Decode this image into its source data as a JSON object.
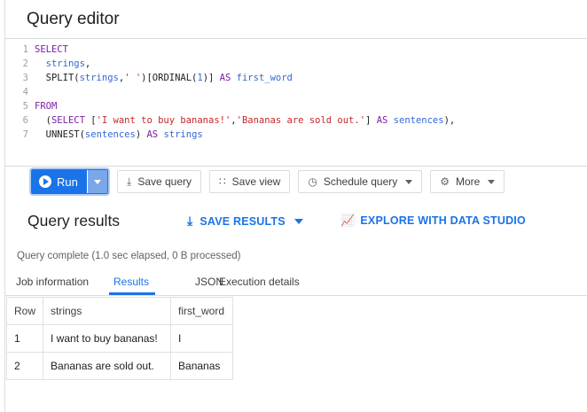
{
  "editor": {
    "title": "Query editor",
    "lines": [
      {
        "n": "1"
      },
      {
        "n": "2"
      },
      {
        "n": "3"
      },
      {
        "n": "4"
      },
      {
        "n": "5"
      },
      {
        "n": "6"
      },
      {
        "n": "7"
      }
    ],
    "code": {
      "l1_kw": "SELECT",
      "l2_id": "strings",
      "l2_txt": ",",
      "l3_a": "SPLIT(",
      "l3_id": "strings",
      "l3_b": ",",
      "l3_str": "' '",
      "l3_c": ")[ORDINAL(",
      "l3_num": "1",
      "l3_d": ")] ",
      "l3_kw": "AS",
      "l3_alias": "first_word",
      "l5_kw": "FROM",
      "l6_a": "(",
      "l6_kw1": "SELECT",
      "l6_b": " [",
      "l6_str1": "'I want to buy bananas!'",
      "l6_c": ",",
      "l6_str2": "'Bananas are sold out.'",
      "l6_d": "] ",
      "l6_kw2": "AS",
      "l6_alias": "sentences",
      "l6_e": "),",
      "l7_a": "UNNEST(",
      "l7_id": "sentences",
      "l7_b": ") ",
      "l7_kw": "AS",
      "l7_alias": "strings"
    }
  },
  "toolbar": {
    "run": "Run",
    "save_query": "Save query",
    "save_view": "Save view",
    "schedule_query": "Schedule query",
    "more": "More"
  },
  "results": {
    "title": "Query results",
    "save_results": "SAVE RESULTS",
    "explore": "EXPLORE WITH DATA STUDIO",
    "status": "Query complete (1.0 sec elapsed, 0 B processed)",
    "tabs": [
      "Job information",
      "Results",
      "JSON",
      "Execution details"
    ],
    "active_tab": "Results",
    "columns": [
      "Row",
      "strings",
      "first_word"
    ],
    "rows": [
      [
        "1",
        "I want to buy bananas!",
        "I"
      ],
      [
        "2",
        "Bananas are sold out.",
        "Bananas"
      ]
    ]
  },
  "colors": {
    "accent": "#1a73e8",
    "keyword": "#7b1fa2",
    "string": "#c62828"
  }
}
